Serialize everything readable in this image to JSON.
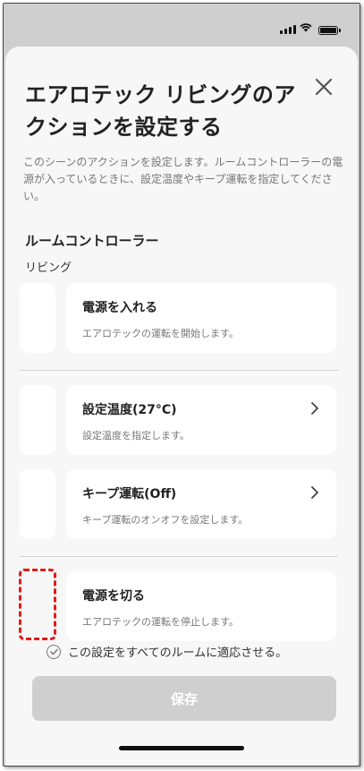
{
  "sheet": {
    "title": "エアロテック リビングのアクションを設定する",
    "description": "このシーンのアクションを設定します。ルームコントローラーの電源が入っているときに、設定温度やキープ運転を指定してください。",
    "section_title": "ルームコントローラー",
    "section_sub": "リビング"
  },
  "actions": [
    {
      "title": "電源を入れる",
      "subtitle": "エアロテックの運転を開始します。"
    },
    {
      "title": "設定温度(27°C)",
      "subtitle": "設定温度を指定します。"
    },
    {
      "title": "キープ運転(Off)",
      "subtitle": "キープ運転のオンオフを設定します。"
    },
    {
      "title": "電源を切る",
      "subtitle": "エアロテックの運転を停止します。"
    }
  ],
  "apply_all_label": "この設定をすべてのルームに適応させる。",
  "save_label": "保存",
  "colors": {
    "background": "#cfcfcf",
    "sheet": "#f7f7f7",
    "card": "#ffffff",
    "save_disabled": "#cfcfcf",
    "highlight": "#e01b1b"
  },
  "icons": {
    "close": "close-icon",
    "chevron": "chevron-right-icon",
    "check": "check-circle-icon"
  }
}
